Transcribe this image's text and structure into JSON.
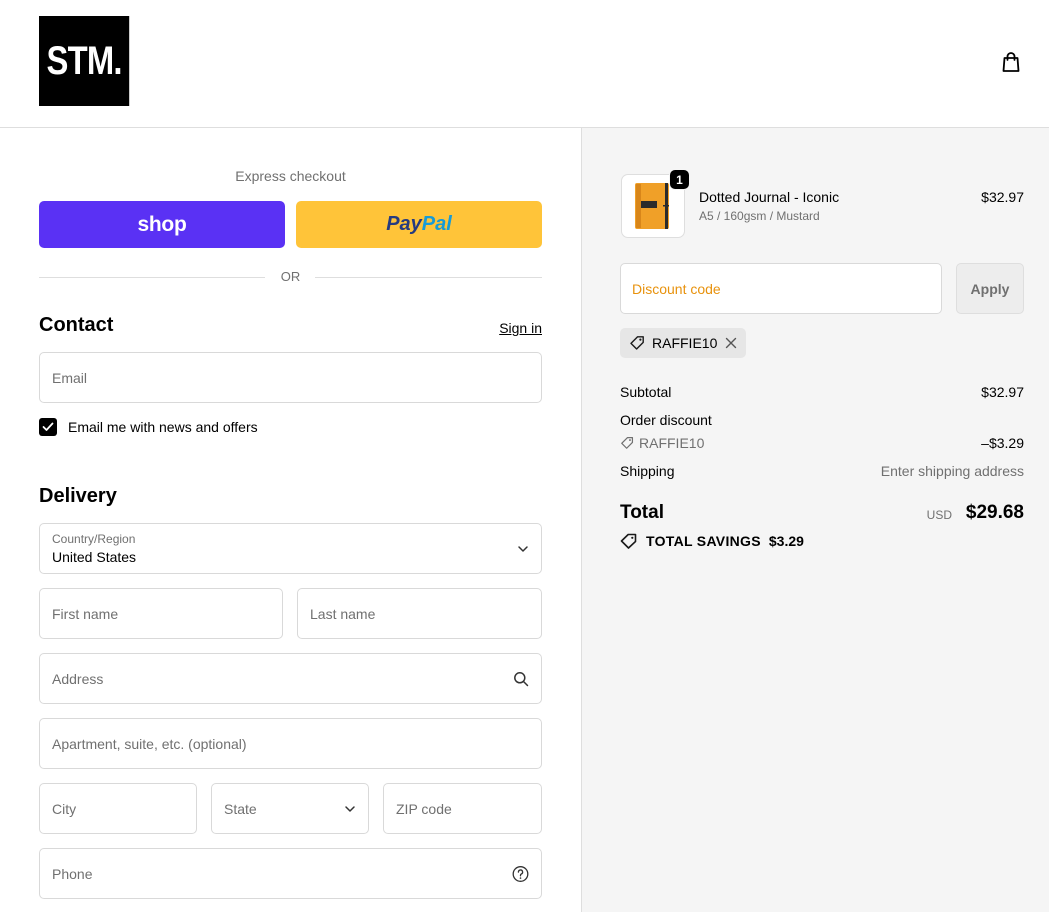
{
  "header": {
    "logo_text": "STM.",
    "cart_icon": "shopping-bag-icon"
  },
  "express": {
    "title": "Express checkout",
    "shop_label": "shop",
    "paypal_part1": "Pay",
    "paypal_part2": "Pal",
    "or_label": "OR"
  },
  "contact": {
    "title": "Contact",
    "signin_label": "Sign in",
    "email_placeholder": "Email",
    "newsletter_label": "Email me with news and offers",
    "newsletter_checked": true
  },
  "delivery": {
    "title": "Delivery",
    "country_label": "Country/Region",
    "country_value": "United States",
    "first_name_placeholder": "First name",
    "last_name_placeholder": "Last name",
    "address_placeholder": "Address",
    "apartment_placeholder": "Apartment, suite, etc. (optional)",
    "city_placeholder": "City",
    "state_placeholder": "State",
    "zip_placeholder": "ZIP code",
    "phone_placeholder": "Phone"
  },
  "order": {
    "item": {
      "name": "Dotted Journal - Iconic",
      "variant": "A5 / 160gsm / Mustard",
      "price": "$32.97",
      "quantity": "1"
    },
    "discount_placeholder": "Discount code",
    "apply_label": "Apply",
    "applied_code": "RAFFIE10",
    "subtotal_label": "Subtotal",
    "subtotal_value": "$32.97",
    "order_discount_label": "Order discount",
    "discount_code_label": "RAFFIE10",
    "discount_value": "–$3.29",
    "shipping_label": "Shipping",
    "shipping_value": "Enter shipping address",
    "total_label": "Total",
    "total_currency": "USD",
    "total_value": "$29.68",
    "savings_label": "TOTAL SAVINGS",
    "savings_value": "$3.29"
  },
  "colors": {
    "shop_pay": "#5a31f4",
    "paypal": "#ffc439",
    "discount_placeholder": "#e8920d"
  }
}
